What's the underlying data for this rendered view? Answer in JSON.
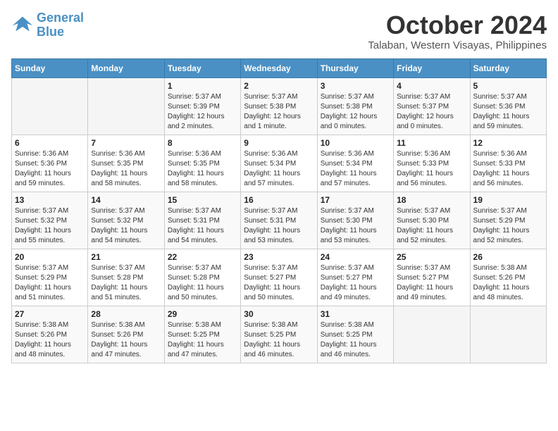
{
  "logo": {
    "line1": "General",
    "line2": "Blue"
  },
  "title": "October 2024",
  "location": "Talaban, Western Visayas, Philippines",
  "weekdays": [
    "Sunday",
    "Monday",
    "Tuesday",
    "Wednesday",
    "Thursday",
    "Friday",
    "Saturday"
  ],
  "weeks": [
    [
      {
        "day": "",
        "info": ""
      },
      {
        "day": "",
        "info": ""
      },
      {
        "day": "1",
        "info": "Sunrise: 5:37 AM\nSunset: 5:39 PM\nDaylight: 12 hours\nand 2 minutes."
      },
      {
        "day": "2",
        "info": "Sunrise: 5:37 AM\nSunset: 5:38 PM\nDaylight: 12 hours\nand 1 minute."
      },
      {
        "day": "3",
        "info": "Sunrise: 5:37 AM\nSunset: 5:38 PM\nDaylight: 12 hours\nand 0 minutes."
      },
      {
        "day": "4",
        "info": "Sunrise: 5:37 AM\nSunset: 5:37 PM\nDaylight: 12 hours\nand 0 minutes."
      },
      {
        "day": "5",
        "info": "Sunrise: 5:37 AM\nSunset: 5:36 PM\nDaylight: 11 hours\nand 59 minutes."
      }
    ],
    [
      {
        "day": "6",
        "info": "Sunrise: 5:36 AM\nSunset: 5:36 PM\nDaylight: 11 hours\nand 59 minutes."
      },
      {
        "day": "7",
        "info": "Sunrise: 5:36 AM\nSunset: 5:35 PM\nDaylight: 11 hours\nand 58 minutes."
      },
      {
        "day": "8",
        "info": "Sunrise: 5:36 AM\nSunset: 5:35 PM\nDaylight: 11 hours\nand 58 minutes."
      },
      {
        "day": "9",
        "info": "Sunrise: 5:36 AM\nSunset: 5:34 PM\nDaylight: 11 hours\nand 57 minutes."
      },
      {
        "day": "10",
        "info": "Sunrise: 5:36 AM\nSunset: 5:34 PM\nDaylight: 11 hours\nand 57 minutes."
      },
      {
        "day": "11",
        "info": "Sunrise: 5:36 AM\nSunset: 5:33 PM\nDaylight: 11 hours\nand 56 minutes."
      },
      {
        "day": "12",
        "info": "Sunrise: 5:36 AM\nSunset: 5:33 PM\nDaylight: 11 hours\nand 56 minutes."
      }
    ],
    [
      {
        "day": "13",
        "info": "Sunrise: 5:37 AM\nSunset: 5:32 PM\nDaylight: 11 hours\nand 55 minutes."
      },
      {
        "day": "14",
        "info": "Sunrise: 5:37 AM\nSunset: 5:32 PM\nDaylight: 11 hours\nand 54 minutes."
      },
      {
        "day": "15",
        "info": "Sunrise: 5:37 AM\nSunset: 5:31 PM\nDaylight: 11 hours\nand 54 minutes."
      },
      {
        "day": "16",
        "info": "Sunrise: 5:37 AM\nSunset: 5:31 PM\nDaylight: 11 hours\nand 53 minutes."
      },
      {
        "day": "17",
        "info": "Sunrise: 5:37 AM\nSunset: 5:30 PM\nDaylight: 11 hours\nand 53 minutes."
      },
      {
        "day": "18",
        "info": "Sunrise: 5:37 AM\nSunset: 5:30 PM\nDaylight: 11 hours\nand 52 minutes."
      },
      {
        "day": "19",
        "info": "Sunrise: 5:37 AM\nSunset: 5:29 PM\nDaylight: 11 hours\nand 52 minutes."
      }
    ],
    [
      {
        "day": "20",
        "info": "Sunrise: 5:37 AM\nSunset: 5:29 PM\nDaylight: 11 hours\nand 51 minutes."
      },
      {
        "day": "21",
        "info": "Sunrise: 5:37 AM\nSunset: 5:28 PM\nDaylight: 11 hours\nand 51 minutes."
      },
      {
        "day": "22",
        "info": "Sunrise: 5:37 AM\nSunset: 5:28 PM\nDaylight: 11 hours\nand 50 minutes."
      },
      {
        "day": "23",
        "info": "Sunrise: 5:37 AM\nSunset: 5:27 PM\nDaylight: 11 hours\nand 50 minutes."
      },
      {
        "day": "24",
        "info": "Sunrise: 5:37 AM\nSunset: 5:27 PM\nDaylight: 11 hours\nand 49 minutes."
      },
      {
        "day": "25",
        "info": "Sunrise: 5:37 AM\nSunset: 5:27 PM\nDaylight: 11 hours\nand 49 minutes."
      },
      {
        "day": "26",
        "info": "Sunrise: 5:38 AM\nSunset: 5:26 PM\nDaylight: 11 hours\nand 48 minutes."
      }
    ],
    [
      {
        "day": "27",
        "info": "Sunrise: 5:38 AM\nSunset: 5:26 PM\nDaylight: 11 hours\nand 48 minutes."
      },
      {
        "day": "28",
        "info": "Sunrise: 5:38 AM\nSunset: 5:26 PM\nDaylight: 11 hours\nand 47 minutes."
      },
      {
        "day": "29",
        "info": "Sunrise: 5:38 AM\nSunset: 5:25 PM\nDaylight: 11 hours\nand 47 minutes."
      },
      {
        "day": "30",
        "info": "Sunrise: 5:38 AM\nSunset: 5:25 PM\nDaylight: 11 hours\nand 46 minutes."
      },
      {
        "day": "31",
        "info": "Sunrise: 5:38 AM\nSunset: 5:25 PM\nDaylight: 11 hours\nand 46 minutes."
      },
      {
        "day": "",
        "info": ""
      },
      {
        "day": "",
        "info": ""
      }
    ]
  ]
}
